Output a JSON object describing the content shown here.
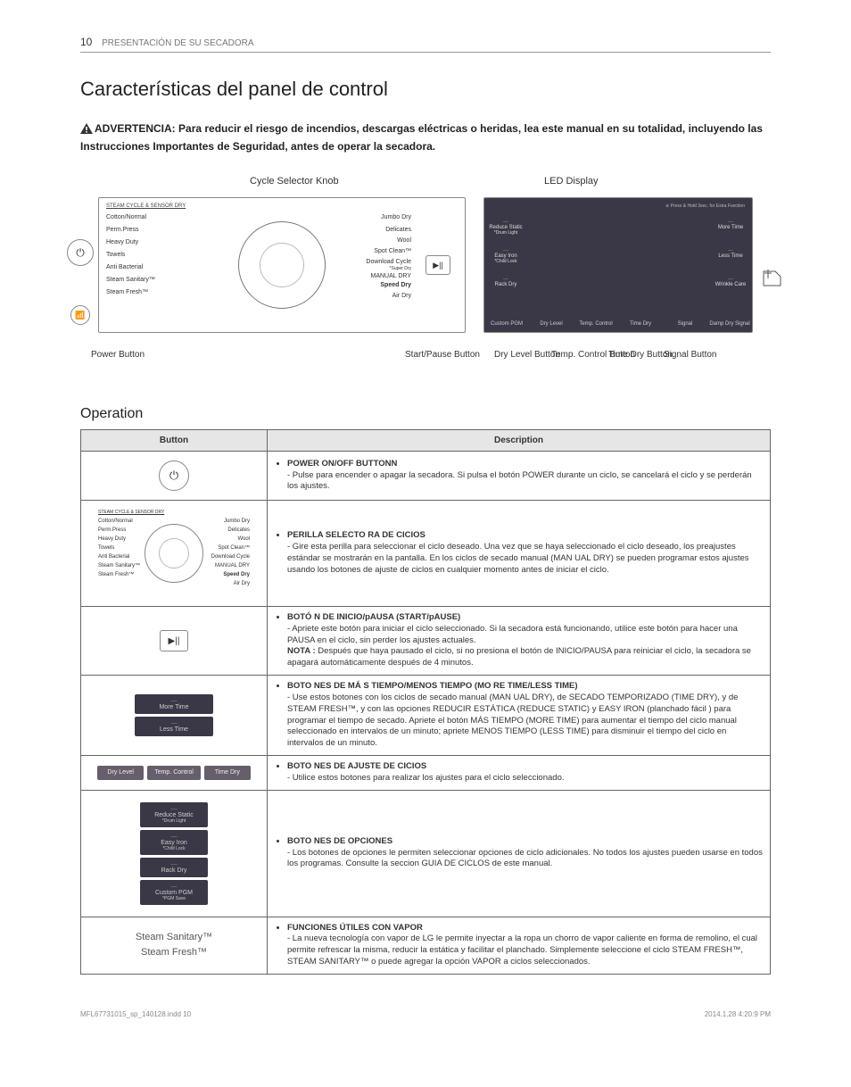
{
  "page": {
    "number": "10",
    "section": "PRESENTACIÓN DE SU SECADORA",
    "h1": "Características del panel de control",
    "warning_prefix": "ADVERTENCIA:",
    "warning": "Para reducir el riesgo de incendios, descargas eléctricas o heridas, lea este manual en su totalidad, incluyendo las Instrucciones Importantes de Seguridad, antes de operar la secadora.",
    "h2": "Operation",
    "footer_left": "MFL67731015_sp_140128.indd   10",
    "footer_right": "2014.1.28   4:20:9 PM"
  },
  "diagram": {
    "top_left": "Cycle Selector Knob",
    "top_right": "LED Display",
    "steam_header": "STEAM CYCLE & SENSOR DRY",
    "left_cycles": [
      "Cotton/Normal",
      "Perm.Press",
      "Heavy Duty",
      "Towels",
      "Anti Bacterial",
      "Steam Sanitary™",
      "Steam Fresh™"
    ],
    "right_cycles": [
      "Jumbo Dry",
      "Delicates",
      "Wool",
      "Spot Clean™",
      "Download Cycle",
      "MANUAL DRY",
      "Speed Dry",
      "Air Dry"
    ],
    "right_sub1": "*Super Dry",
    "led_tiny": "※ Press & Hold 3sec. for Extra Function",
    "led_left": [
      "Reduce Static",
      "Easy Iron",
      "Rack Dry",
      "Custom PGM"
    ],
    "led_left_sub": [
      "*Drum Light",
      "*Child Lock",
      "",
      "*PGM Save"
    ],
    "led_right": [
      "More Time",
      "Less Time",
      "Wrinkle Care"
    ],
    "led_bottom": [
      "Custom PGM",
      "Dry Level",
      "Temp. Control",
      "Time Dry",
      "Signal",
      "Damp Dry Signal"
    ],
    "led_bottom_sub": "*PGM Save",
    "callouts": {
      "power": "Power Button",
      "start": "Start/Pause Button",
      "dry": "Dry Level Button",
      "temp": "Temp. Control Button",
      "time": "Time Dry Button",
      "signal": "Signal Button"
    }
  },
  "table": {
    "h_button": "Button",
    "h_desc": "Description",
    "rows": [
      {
        "title": "POWER ON/OFF BUTTONN",
        "body": "- Pulse para encender o apagar la secadora. Si pulsa el botón POWER durante un ciclo, se cancelará el ciclo y se perderán los ajustes."
      },
      {
        "title": "PERILLA SELECTO RA DE CICIOS",
        "body": "- Gire esta perilla para seleccionar el ciclo deseado. Una vez que se haya seleccionado el ciclo deseado, los preajustes estándar se mostrarán en la pantalla. En los ciclos de secado manual (MAN UAL DRY) se pueden programar estos ajustes usando los botones de ajuste de ciclos en cualquier momento antes de iniciar el ciclo."
      },
      {
        "title": "BOTÓ N DE INICIO/pAUSA (START/pAUSE)",
        "body": "- Apriete este botón para iniciar el ciclo seleccionado. Si la secadora está funcionando, utilice este botón para hacer una PAUSA en el ciclo, sin perder los ajustes actuales.",
        "note_label": "NOTA :",
        "note": " Después que haya pausado el ciclo, si no presiona el botón de INICIO/PAUSA para reiniciar el ciclo, la secadora se apagará automáticamente después de 4 minutos."
      },
      {
        "title": "BOTO NES DE MÁ S TIEMPO/MENOS TIEMPO (MO RE TIME/LESS TIME)",
        "body": "- Use estos botones con los ciclos de secado manual (MAN UAL DRY), de SECADO TEMPORIZADO (TIME DRY), y de STEAM FRESH™, y con las opciones REDUCIR ESTÁTICA (REDUCE STATIC) y EASY IRON (planchado fácil ) para programar el tiempo de secado. Apriete el botón MÁS TIEMPO (MORE TIME) para aumentar el tiempo del ciclo manual seleccionado en intervalos de un minuto; apriete MENOS TIEMPO (LESS TIME) para disminuir el tiempo del ciclo en intervalos de un minuto."
      },
      {
        "title": "BOTO NES DE AJUSTE DE CICIOS",
        "body": "- Utilice estos botones para realizar los ajustes para el ciclo seleccionado."
      },
      {
        "title": "BOTO NES DE OPCIONES",
        "body": "- Los botones de opciones le permiten seleccionar opciones de ciclo adicionales. No todos los ajustes pueden usarse en todos los programas. Consulte la seccion GUIA DE CICLOS de este manual."
      },
      {
        "title": "FUNCIONES ÚTILES CON VAPOR",
        "body": "- La nueva tecnología con vapor de LG le permite inyectar a la ropa un chorro de vapor caliente en forma de remolino, el cual permite refrescar la misma, reducir la estática y facilitar el planchado. Simplemente seleccione el ciclo STEAM FRESH™, STEAM SANITARY™ o puede agregar la opción VAPOR a ciclos seleccionados."
      }
    ],
    "steam_labels": [
      "Steam Sanitary™",
      "Steam Fresh™"
    ],
    "more_less": [
      "More Time",
      "Less Time"
    ],
    "adjust_pills": [
      "Dry Level",
      "Temp. Control",
      "Time Dry"
    ],
    "option_pills": [
      "Reduce Static",
      "Easy Iron",
      "Rack Dry",
      "Custom PGM"
    ],
    "option_subs": [
      "*Drum Light",
      "*Child Lock",
      "",
      "*PGM Save"
    ]
  }
}
